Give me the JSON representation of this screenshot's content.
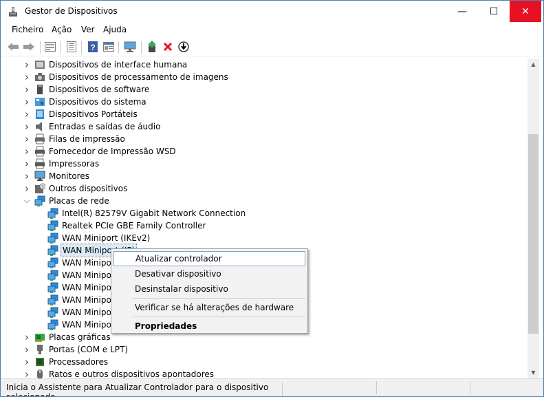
{
  "window": {
    "title": "Gestor de Dispositivos",
    "minimize_glyph": "—",
    "maximize_glyph": "☐",
    "close_glyph": "✕"
  },
  "menu": [
    "Ficheiro",
    "Ação",
    "Ver",
    "Ajuda"
  ],
  "toolbar": [
    "back-arrow-icon",
    "forward-arrow-icon",
    "properties-icon",
    "list-icon",
    "help-icon",
    "view-icon",
    "monitor-icon",
    "update-driver-icon",
    "uninstall-icon",
    "download-icon"
  ],
  "tree": {
    "rows": [
      {
        "label": "Dispositivos de interface humana",
        "icon": "hid-icon",
        "expander": "collapsed",
        "level": 0
      },
      {
        "label": "Dispositivos de processamento de imagens",
        "icon": "imaging-icon",
        "expander": "collapsed",
        "level": 0
      },
      {
        "label": "Dispositivos de software",
        "icon": "software-device-icon",
        "expander": "collapsed",
        "level": 0
      },
      {
        "label": "Dispositivos do sistema",
        "icon": "system-device-icon",
        "expander": "collapsed",
        "level": 0
      },
      {
        "label": "Dispositivos Portáteis",
        "icon": "portable-device-icon",
        "expander": "collapsed",
        "level": 0
      },
      {
        "label": "Entradas e saídas de áudio",
        "icon": "speaker-icon",
        "expander": "collapsed",
        "level": 0
      },
      {
        "label": "Filas de impressão",
        "icon": "print-queue-icon",
        "expander": "collapsed",
        "level": 0
      },
      {
        "label": "Fornecedor de Impressão WSD",
        "icon": "printer-icon",
        "expander": "collapsed",
        "level": 0
      },
      {
        "label": "Impressoras",
        "icon": "printer-icon",
        "expander": "collapsed",
        "level": 0
      },
      {
        "label": "Monitores",
        "icon": "monitor-icon",
        "expander": "collapsed",
        "level": 0
      },
      {
        "label": "Outros dispositivos",
        "icon": "unknown-device-icon",
        "expander": "collapsed",
        "level": 0
      },
      {
        "label": "Placas de rede",
        "icon": "network-adapter-icon",
        "expander": "expanded",
        "level": 0
      },
      {
        "label": "Intel(R) 82579V Gigabit Network Connection",
        "icon": "network-adapter-icon",
        "expander": "none",
        "level": 1
      },
      {
        "label": "Realtek PCIe GBE Family Controller",
        "icon": "network-adapter-icon",
        "expander": "none",
        "level": 1
      },
      {
        "label": "WAN Miniport (IKEv2)",
        "icon": "network-adapter-icon",
        "expander": "none",
        "level": 1
      },
      {
        "label": "WAN Miniport (IP)",
        "icon": "network-adapter-icon",
        "expander": "none",
        "level": 1,
        "selected": true
      },
      {
        "label": "WAN Miniport",
        "icon": "network-adapter-icon",
        "expander": "none",
        "level": 1
      },
      {
        "label": "WAN Miniport",
        "icon": "network-adapter-icon",
        "expander": "none",
        "level": 1
      },
      {
        "label": "WAN Miniport",
        "icon": "network-adapter-icon",
        "expander": "none",
        "level": 1
      },
      {
        "label": "WAN Miniport",
        "icon": "network-adapter-icon",
        "expander": "none",
        "level": 1
      },
      {
        "label": "WAN Miniport",
        "icon": "network-adapter-icon",
        "expander": "none",
        "level": 1
      },
      {
        "label": "WAN Miniport",
        "icon": "network-adapter-icon",
        "expander": "none",
        "level": 1
      },
      {
        "label": "Placas gráficas",
        "icon": "display-adapter-icon",
        "expander": "collapsed",
        "level": 0
      },
      {
        "label": "Portas (COM e LPT)",
        "icon": "port-icon",
        "expander": "collapsed",
        "level": 0
      },
      {
        "label": "Processadores",
        "icon": "processor-icon",
        "expander": "collapsed",
        "level": 0
      },
      {
        "label": "Ratos e outros dispositivos apontadores",
        "icon": "mouse-icon",
        "expander": "collapsed",
        "level": 0
      }
    ]
  },
  "context_menu": {
    "items": [
      {
        "label": "Atualizar controlador",
        "highlighted": true,
        "bold": false
      },
      {
        "label": "Desativar dispositivo",
        "highlighted": false,
        "bold": false
      },
      {
        "label": "Desinstalar dispositivo",
        "highlighted": false,
        "bold": false
      },
      {
        "separator": true
      },
      {
        "label": "Verificar se há alterações de hardware",
        "highlighted": false,
        "bold": false
      },
      {
        "separator": true
      },
      {
        "label": "Propriedades",
        "highlighted": false,
        "bold": true
      }
    ]
  },
  "status": {
    "text": "Inicia o Assistente para Atualizar Controlador para o dispositivo selecionado."
  },
  "colors": {
    "accent": "#0078d7",
    "close_hover": "#e81123",
    "selection": "#d9ebf9",
    "network_icon": "#2e8bd8",
    "error_red": "#e81123"
  }
}
